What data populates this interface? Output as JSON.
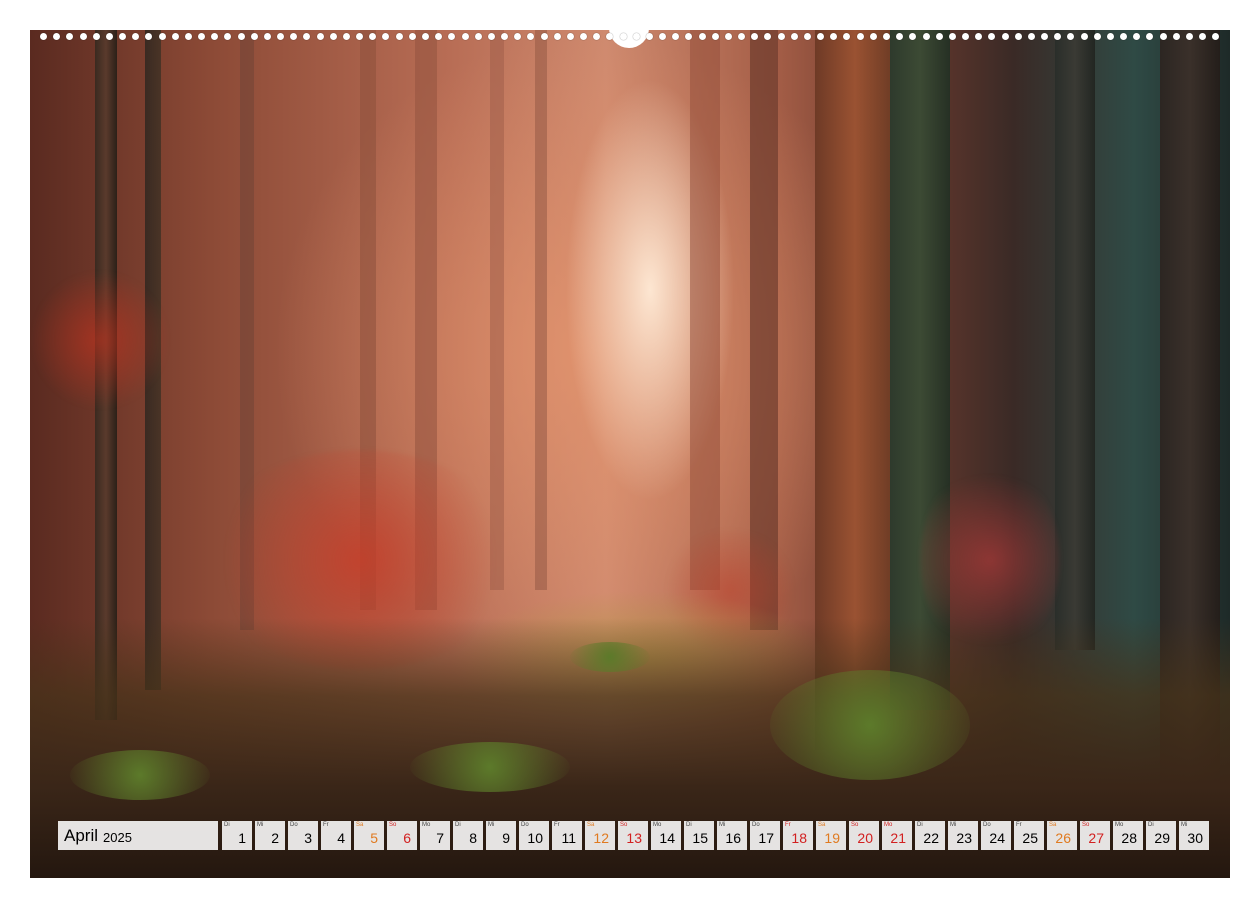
{
  "calendar": {
    "month": "April",
    "year": "2025",
    "days": [
      {
        "dn": "Di",
        "d": "1",
        "type": "weekday"
      },
      {
        "dn": "Mi",
        "d": "2",
        "type": "weekday"
      },
      {
        "dn": "Do",
        "d": "3",
        "type": "weekday"
      },
      {
        "dn": "Fr",
        "d": "4",
        "type": "weekday"
      },
      {
        "dn": "Sa",
        "d": "5",
        "type": "sat"
      },
      {
        "dn": "So",
        "d": "6",
        "type": "sun"
      },
      {
        "dn": "Mo",
        "d": "7",
        "type": "weekday"
      },
      {
        "dn": "Di",
        "d": "8",
        "type": "weekday"
      },
      {
        "dn": "Mi",
        "d": "9",
        "type": "weekday"
      },
      {
        "dn": "Do",
        "d": "10",
        "type": "weekday"
      },
      {
        "dn": "Fr",
        "d": "11",
        "type": "weekday"
      },
      {
        "dn": "Sa",
        "d": "12",
        "type": "sat"
      },
      {
        "dn": "So",
        "d": "13",
        "type": "sun"
      },
      {
        "dn": "Mo",
        "d": "14",
        "type": "weekday"
      },
      {
        "dn": "Di",
        "d": "15",
        "type": "weekday"
      },
      {
        "dn": "Mi",
        "d": "16",
        "type": "weekday"
      },
      {
        "dn": "Do",
        "d": "17",
        "type": "weekday"
      },
      {
        "dn": "Fr",
        "d": "18",
        "type": "sun"
      },
      {
        "dn": "Sa",
        "d": "19",
        "type": "sat"
      },
      {
        "dn": "So",
        "d": "20",
        "type": "sun"
      },
      {
        "dn": "Mo",
        "d": "21",
        "type": "sun"
      },
      {
        "dn": "Di",
        "d": "22",
        "type": "weekday"
      },
      {
        "dn": "Mi",
        "d": "23",
        "type": "weekday"
      },
      {
        "dn": "Do",
        "d": "24",
        "type": "weekday"
      },
      {
        "dn": "Fr",
        "d": "25",
        "type": "weekday"
      },
      {
        "dn": "Sa",
        "d": "26",
        "type": "sat"
      },
      {
        "dn": "So",
        "d": "27",
        "type": "sun"
      },
      {
        "dn": "Mo",
        "d": "28",
        "type": "weekday"
      },
      {
        "dn": "Di",
        "d": "29",
        "type": "weekday"
      },
      {
        "dn": "Mi",
        "d": "30",
        "type": "weekday"
      }
    ]
  },
  "colors": {
    "saturday": "#e07a20",
    "sunday_holiday": "#d22020"
  }
}
